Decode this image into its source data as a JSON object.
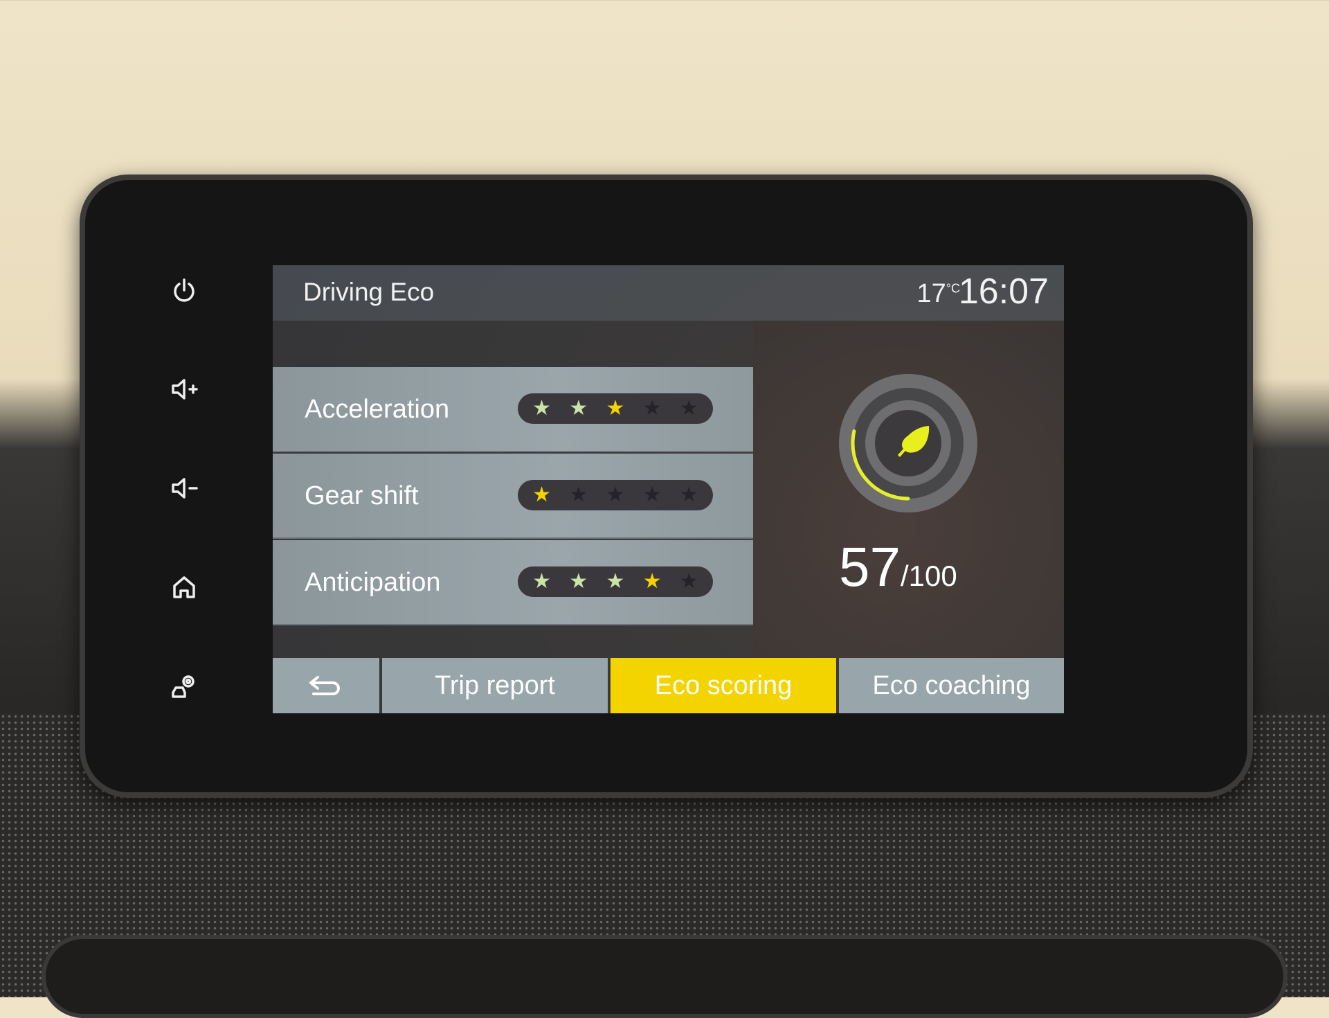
{
  "header": {
    "title": "Driving Eco",
    "temperature": "17",
    "temperature_unit": "°C",
    "time": "16:07"
  },
  "ratings": [
    {
      "label": "Acceleration",
      "stars": 3,
      "max": 5
    },
    {
      "label": "Gear shift",
      "stars": 1,
      "max": 5
    },
    {
      "label": "Anticipation",
      "stars": 4,
      "max": 5
    }
  ],
  "score": {
    "value": "57",
    "max": "/100",
    "icon": "leaf-icon"
  },
  "tabs": [
    {
      "label": "Trip report",
      "active": false
    },
    {
      "label": "Eco scoring",
      "active": true
    },
    {
      "label": "Eco coaching",
      "active": false
    }
  ],
  "back_icon": "back-arrow-icon",
  "side_buttons": [
    "power-icon",
    "volume-up-icon",
    "volume-down-icon",
    "home-icon",
    "driver-settings-icon"
  ],
  "colors": {
    "accent": "#f3d400",
    "star_pale": "#c9e3a8",
    "star_off": "#24232a",
    "tab": "#98a5aa"
  }
}
